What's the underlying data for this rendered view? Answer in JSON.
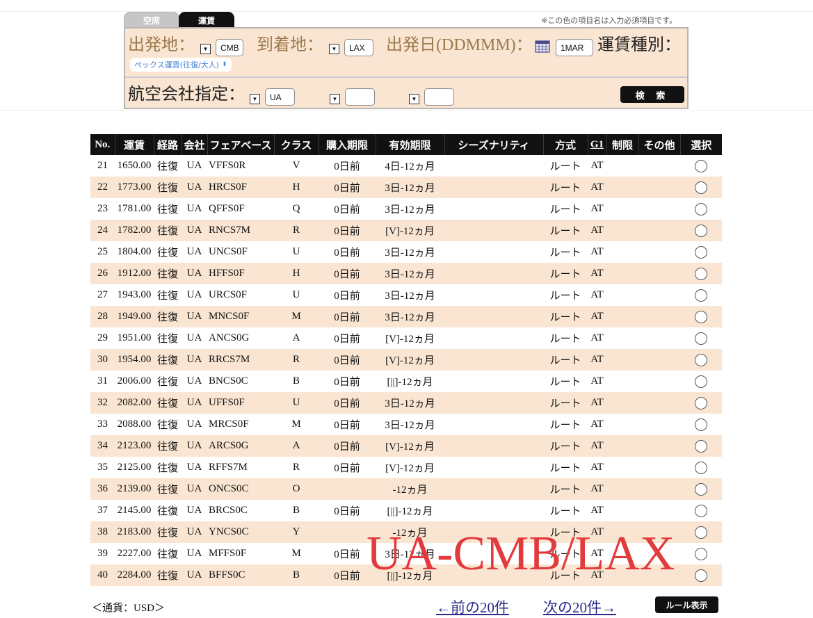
{
  "tabs": {
    "vacancy": "空席",
    "fare": "運賃"
  },
  "required_note": "※この色の項目名は入力必須項目です。",
  "search": {
    "origin_label": "出発地：",
    "origin_value": "CMB",
    "destination_label": "到着地：",
    "destination_value": "LAX",
    "date_label": "出発日(DDMMM)：",
    "date_value": "1MAR",
    "fare_type_label": "運賃種別：",
    "fare_type_value": "ペックス運賃(往復/大人)",
    "airline_label": "航空会社指定：",
    "airline_value_1": "UA",
    "airline_value_2": "",
    "airline_value_3": "",
    "search_button": "検 索"
  },
  "table": {
    "headers": [
      "No.",
      "運賃",
      "経路",
      "会社",
      "フェアベース",
      "クラス",
      "購入期限",
      "有効期限",
      "シーズナリティ",
      "方式",
      "G1",
      "制限",
      "その他",
      "選択"
    ],
    "rows": [
      {
        "no": "21",
        "fare": "1650.00",
        "route": "往復",
        "airline": "UA",
        "basis": "VFFS0R",
        "class": "V",
        "purchase": "0日前",
        "validity": "4日-12ヵ月",
        "season": "",
        "method": "ルート",
        "g1": "AT"
      },
      {
        "no": "22",
        "fare": "1773.00",
        "route": "往復",
        "airline": "UA",
        "basis": "HRCS0F",
        "class": "H",
        "purchase": "0日前",
        "validity": "3日-12ヵ月",
        "season": "",
        "method": "ルート",
        "g1": "AT"
      },
      {
        "no": "23",
        "fare": "1781.00",
        "route": "往復",
        "airline": "UA",
        "basis": "QFFS0F",
        "class": "Q",
        "purchase": "0日前",
        "validity": "3日-12ヵ月",
        "season": "",
        "method": "ルート",
        "g1": "AT"
      },
      {
        "no": "24",
        "fare": "1782.00",
        "route": "往復",
        "airline": "UA",
        "basis": "RNCS7M",
        "class": "R",
        "purchase": "0日前",
        "validity": "[V]-12ヵ月",
        "season": "",
        "method": "ルート",
        "g1": "AT"
      },
      {
        "no": "25",
        "fare": "1804.00",
        "route": "往復",
        "airline": "UA",
        "basis": "UNCS0F",
        "class": "U",
        "purchase": "0日前",
        "validity": "3日-12ヵ月",
        "season": "",
        "method": "ルート",
        "g1": "AT"
      },
      {
        "no": "26",
        "fare": "1912.00",
        "route": "往復",
        "airline": "UA",
        "basis": "HFFS0F",
        "class": "H",
        "purchase": "0日前",
        "validity": "3日-12ヵ月",
        "season": "",
        "method": "ルート",
        "g1": "AT"
      },
      {
        "no": "27",
        "fare": "1943.00",
        "route": "往復",
        "airline": "UA",
        "basis": "URCS0F",
        "class": "U",
        "purchase": "0日前",
        "validity": "3日-12ヵ月",
        "season": "",
        "method": "ルート",
        "g1": "AT"
      },
      {
        "no": "28",
        "fare": "1949.00",
        "route": "往復",
        "airline": "UA",
        "basis": "MNCS0F",
        "class": "M",
        "purchase": "0日前",
        "validity": "3日-12ヵ月",
        "season": "",
        "method": "ルート",
        "g1": "AT"
      },
      {
        "no": "29",
        "fare": "1951.00",
        "route": "往復",
        "airline": "UA",
        "basis": "ANCS0G",
        "class": "A",
        "purchase": "0日前",
        "validity": "[V]-12ヵ月",
        "season": "",
        "method": "ルート",
        "g1": "AT"
      },
      {
        "no": "30",
        "fare": "1954.00",
        "route": "往復",
        "airline": "UA",
        "basis": "RRCS7M",
        "class": "R",
        "purchase": "0日前",
        "validity": "[V]-12ヵ月",
        "season": "",
        "method": "ルート",
        "g1": "AT"
      },
      {
        "no": "31",
        "fare": "2006.00",
        "route": "往復",
        "airline": "UA",
        "basis": "BNCS0C",
        "class": "B",
        "purchase": "0日前",
        "validity": "[||]-12ヵ月",
        "season": "",
        "method": "ルート",
        "g1": "AT"
      },
      {
        "no": "32",
        "fare": "2082.00",
        "route": "往復",
        "airline": "UA",
        "basis": "UFFS0F",
        "class": "U",
        "purchase": "0日前",
        "validity": "3日-12ヵ月",
        "season": "",
        "method": "ルート",
        "g1": "AT"
      },
      {
        "no": "33",
        "fare": "2088.00",
        "route": "往復",
        "airline": "UA",
        "basis": "MRCS0F",
        "class": "M",
        "purchase": "0日前",
        "validity": "3日-12ヵ月",
        "season": "",
        "method": "ルート",
        "g1": "AT"
      },
      {
        "no": "34",
        "fare": "2123.00",
        "route": "往復",
        "airline": "UA",
        "basis": "ARCS0G",
        "class": "A",
        "purchase": "0日前",
        "validity": "[V]-12ヵ月",
        "season": "",
        "method": "ルート",
        "g1": "AT"
      },
      {
        "no": "35",
        "fare": "2125.00",
        "route": "往復",
        "airline": "UA",
        "basis": "RFFS7M",
        "class": "R",
        "purchase": "0日前",
        "validity": "[V]-12ヵ月",
        "season": "",
        "method": "ルート",
        "g1": "AT"
      },
      {
        "no": "36",
        "fare": "2139.00",
        "route": "往復",
        "airline": "UA",
        "basis": "ONCS0C",
        "class": "O",
        "purchase": "",
        "validity": "-12ヵ月",
        "season": "",
        "method": "ルート",
        "g1": "AT"
      },
      {
        "no": "37",
        "fare": "2145.00",
        "route": "往復",
        "airline": "UA",
        "basis": "BRCS0C",
        "class": "B",
        "purchase": "0日前",
        "validity": "[||]-12ヵ月",
        "season": "",
        "method": "ルート",
        "g1": "AT"
      },
      {
        "no": "38",
        "fare": "2183.00",
        "route": "往復",
        "airline": "UA",
        "basis": "YNCS0C",
        "class": "Y",
        "purchase": "",
        "validity": "-12ヵ月",
        "season": "",
        "method": "ルート",
        "g1": "AT"
      },
      {
        "no": "39",
        "fare": "2227.00",
        "route": "往復",
        "airline": "UA",
        "basis": "MFFS0F",
        "class": "M",
        "purchase": "0日前",
        "validity": "3日-12ヵ月",
        "season": "",
        "method": "ルート",
        "g1": "AT"
      },
      {
        "no": "40",
        "fare": "2284.00",
        "route": "往復",
        "airline": "UA",
        "basis": "BFFS0C",
        "class": "B",
        "purchase": "0日前",
        "validity": "[||]-12ヵ月",
        "season": "",
        "method": "ルート",
        "g1": "AT"
      }
    ]
  },
  "footer": {
    "currency": "＜通貨：USD＞",
    "prev_link": "←前の20件",
    "next_link": "次の20件→",
    "rule_button": "ルール表示"
  },
  "watermark": "UA-CMB/LAX",
  "colors": {
    "panel_bg": "#f9e5d1",
    "row_alt_bg": "#f9e5d1",
    "header_bg": "#111111",
    "required_label": "#9b7a4e",
    "link": "#2a2a8a",
    "watermark": "#e23a3d",
    "pill_text": "#3d7fd4"
  }
}
